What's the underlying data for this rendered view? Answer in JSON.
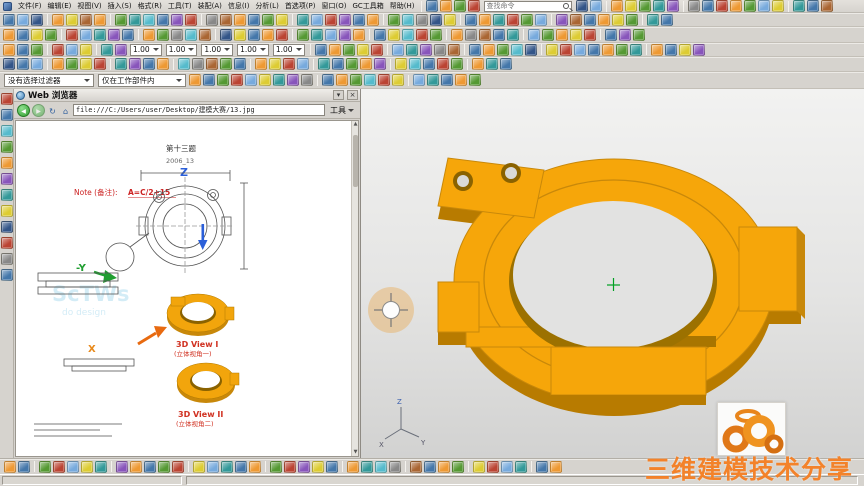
{
  "menu": {
    "items": [
      "文件(F)",
      "编辑(E)",
      "视图(V)",
      "插入(S)",
      "格式(R)",
      "工具(T)",
      "装配(A)",
      "信息(I)",
      "分析(L)",
      "首选项(P)",
      "窗口(O)",
      "GC工具箱",
      "帮助(H)"
    ]
  },
  "toolbars": {
    "search_placeholder": "查找命令",
    "row1a": [
      "#47a",
      "#e93",
      "#593",
      "#b43"
    ],
    "row1b": [
      "#358",
      "#7ad",
      "sep",
      "#e93",
      "#dc3",
      "#593",
      "#399",
      "#85b",
      "sep",
      "#888",
      "#47a",
      "#b43",
      "#e93",
      "#593",
      "#7ad",
      "#dc3",
      "sep",
      "#399",
      "#47a",
      "#a63"
    ],
    "row2": [
      "#47a",
      "#7ad",
      "#358",
      "sep",
      "#e93",
      "#dc3",
      "#a63",
      "#e93",
      "sep",
      "#593",
      "#399",
      "#5bc",
      "#47a",
      "#85b",
      "#b43",
      "sep",
      "#888",
      "#a63",
      "#e93",
      "#47a",
      "#593",
      "#dc3",
      "sep",
      "#399",
      "#7ad",
      "#b43",
      "#85b",
      "#47a",
      "#e93",
      "sep",
      "#593",
      "#5bc",
      "#888",
      "#358",
      "#dc3",
      "sep",
      "#47a",
      "#e93",
      "#399",
      "#b43",
      "#593",
      "#7ad",
      "sep",
      "#85b",
      "#a63",
      "#47a",
      "#e93",
      "#dc3",
      "#593",
      "sep",
      "#399",
      "#47a"
    ],
    "row3": [
      "#e93",
      "#47a",
      "#dc3",
      "#593",
      "sep",
      "#b43",
      "#7ad",
      "#399",
      "#85b",
      "#47a",
      "sep",
      "#e93",
      "#593",
      "#888",
      "#5bc",
      "#a63",
      "sep",
      "#358",
      "#dc3",
      "#47a",
      "#e93",
      "#b43",
      "sep",
      "#593",
      "#399",
      "#7ad",
      "#85b",
      "#e93",
      "sep",
      "#47a",
      "#dc3",
      "#5bc",
      "#b43",
      "#593",
      "sep",
      "#e93",
      "#888",
      "#a63",
      "#47a",
      "#399",
      "sep",
      "#7ad",
      "#593",
      "#e93",
      "#dc3",
      "#b43",
      "sep",
      "#47a",
      "#85b",
      "#593"
    ],
    "row4": [
      "#e93",
      "#47a",
      "#593",
      "sep",
      "#b43",
      "#7ad",
      "#dc3",
      "sep",
      "#399",
      "#85b",
      "f:1.00",
      "f:1.00",
      "f:1.00",
      "f:1.00",
      "f:1.00",
      "sep",
      "#47a",
      "#e93",
      "#593",
      "#dc3",
      "#b43",
      "sep",
      "#7ad",
      "#399",
      "#85b",
      "#888",
      "#a63",
      "sep",
      "#47a",
      "#e93",
      "#593",
      "#5bc",
      "#358",
      "sep",
      "#dc3",
      "#b43",
      "#7ad",
      "#47a",
      "#e93",
      "#593",
      "#399",
      "sep",
      "#e93",
      "#47a",
      "#dc3",
      "#85b"
    ],
    "row5": [
      "#358",
      "#47a",
      "#7ad",
      "sep",
      "#e93",
      "#593",
      "#dc3",
      "#b43",
      "sep",
      "#399",
      "#85b",
      "#47a",
      "#e93",
      "sep",
      "#5bc",
      "#888",
      "#a63",
      "#593",
      "#47a",
      "sep",
      "#e93",
      "#dc3",
      "#b43",
      "#7ad",
      "sep",
      "#399",
      "#47a",
      "#593",
      "#e93",
      "#85b",
      "sep",
      "#dc3",
      "#5bc",
      "#47a",
      "#b43",
      "#593",
      "sep",
      "#e93",
      "#399",
      "#47a"
    ],
    "selection_filter": "没有选择过滤器",
    "selection_scope": "仅在工作部件内",
    "row6": [
      "#e93",
      "#47a",
      "#593",
      "#b43",
      "#7ad",
      "#dc3",
      "#399",
      "#85b",
      "#888",
      "sep",
      "#47a",
      "#e93",
      "#593",
      "#5bc",
      "#b43",
      "#dc3",
      "sep",
      "#7ad",
      "#399",
      "#47a",
      "#e93",
      "#593"
    ]
  },
  "left_toolbar": {
    "icons": [
      "#b43",
      "#47a",
      "#5bc",
      "#593",
      "#e93",
      "#85b",
      "#399",
      "#dc3",
      "#358",
      "#b43",
      "#888",
      "#47a"
    ]
  },
  "bottom_toolbar": {
    "icons": [
      "#e93",
      "#47a",
      "sep",
      "#593",
      "#b43",
      "#7ad",
      "#dc3",
      "#399",
      "sep",
      "#85b",
      "#e93",
      "#47a",
      "#593",
      "#b43",
      "sep",
      "#dc3",
      "#7ad",
      "#399",
      "#47a",
      "#e93",
      "sep",
      "#593",
      "#b43",
      "#85b",
      "#dc3",
      "#47a",
      "sep",
      "#e93",
      "#399",
      "#5bc",
      "#888",
      "sep",
      "#a63",
      "#47a",
      "#e93",
      "#593",
      "sep",
      "#dc3",
      "#b43",
      "#7ad",
      "#399",
      "sep",
      "#47a",
      "#e93"
    ]
  },
  "browser_panel": {
    "title": "Web 浏览器",
    "tools_label": "工具",
    "url": "file:///C:/Users/user/Desktop/建模大赛/13.jpg",
    "drawing": {
      "title": "第十三题",
      "code": "2006_13",
      "note_label": "Note (备注):",
      "note_formula": "A=C/2+15",
      "axis_z": "Z",
      "axis_y": "-Y",
      "axis_x": "X",
      "view1_label": "3D View I",
      "view1_sub": "(立体视角一)",
      "view2_label": "3D View II",
      "view2_sub": "(立体视角二)",
      "watermark_line1": "ScTWs",
      "watermark_line2": "do design"
    }
  },
  "viewport": {
    "part_color": "#f6a60a",
    "part_shadow": "#b87b00",
    "bg_top": "#f2f2f1",
    "bg_bottom": "#d2d2d1"
  },
  "watermark": {
    "text": "三维建模技术分享",
    "color": "#f37c20"
  }
}
